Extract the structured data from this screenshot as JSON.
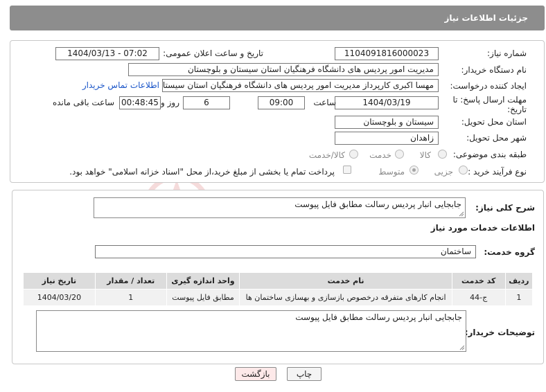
{
  "header": {
    "title": "جزئیات اطلاعات نیاز"
  },
  "form": {
    "need_number": {
      "label": "شماره نیاز:",
      "value": "1104091816000023"
    },
    "announce_datetime": {
      "label": "تاریخ و ساعت اعلان عمومی:",
      "value": "1404/03/13 - 07:02"
    },
    "buyer_org": {
      "label": "نام دستگاه خریدار:",
      "value": "مدیریت امور پردیس های دانشگاه فرهنگیان استان سیستان و بلوچستان"
    },
    "requester": {
      "label": "ایجاد کننده درخواست:",
      "value": "مهسا اکبری کارپرداز مدیریت امور پردیس های دانشگاه فرهنگیان استان سیستان",
      "contact_link": "اطلاعات تماس خریدار"
    },
    "deadline": {
      "label_line1": "مهلت ارسال پاسخ: تا",
      "label_line2": "تاریخ:",
      "date": "1404/03/19",
      "time_label": "ساعت",
      "time": "09:00",
      "days": "6",
      "days_label": "روز و",
      "remaining": "00:48:45",
      "remaining_label": "ساعت باقی مانده"
    },
    "province": {
      "label": "استان محل تحویل:",
      "value": "سیستان و بلوچستان"
    },
    "city": {
      "label": "شهر محل تحویل:",
      "value": "زاهدان"
    },
    "category": {
      "label": "طبقه بندی موضوعی:",
      "options": [
        "کالا",
        "خدمت",
        "کالا/خدمت"
      ],
      "selected": "خدمت"
    },
    "purchase_type": {
      "label": "نوع فرآیند خرید :",
      "options": [
        "جزیی",
        "متوسط"
      ],
      "selected": "متوسط",
      "note": "پرداخت تمام یا بخشی از مبلغ خرید،از محل \"اسناد خزانه اسلامی\" خواهد بود."
    }
  },
  "summary": {
    "label": "شرح کلی نیاز:",
    "value": "جابجایی انبار پردیس رسالت مطابق فایل پیوست"
  },
  "services": {
    "title": "اطلاعات خدمات مورد نیاز",
    "group_label": "گروه خدمت:",
    "group_value": "ساختمان",
    "table": {
      "headers": [
        "ردیف",
        "کد خدمت",
        "نام خدمت",
        "واحد اندازه گیری",
        "تعداد / مقدار",
        "تاریخ نیاز"
      ],
      "rows": [
        [
          "1",
          "ج-44",
          "انجام کارهای متفرقه درخصوص بازسازی و بهسازی ساختمان ها",
          "مطابق فایل پیوست",
          "1",
          "1404/03/20"
        ]
      ]
    }
  },
  "buyer_notes": {
    "label": "توضیحات خریدار:",
    "value": "جابجایی انبار پردیس رسالت مطابق فایل پیوست"
  },
  "buttons": {
    "print": "چاپ",
    "back": "بازگشت"
  },
  "watermark": {
    "text": "AriaTender.neT"
  },
  "colors": {
    "header_bg": "#8d8d8d",
    "link": "#1a55c8",
    "back_button": "#fde9e9",
    "watermark": "#c62828"
  }
}
